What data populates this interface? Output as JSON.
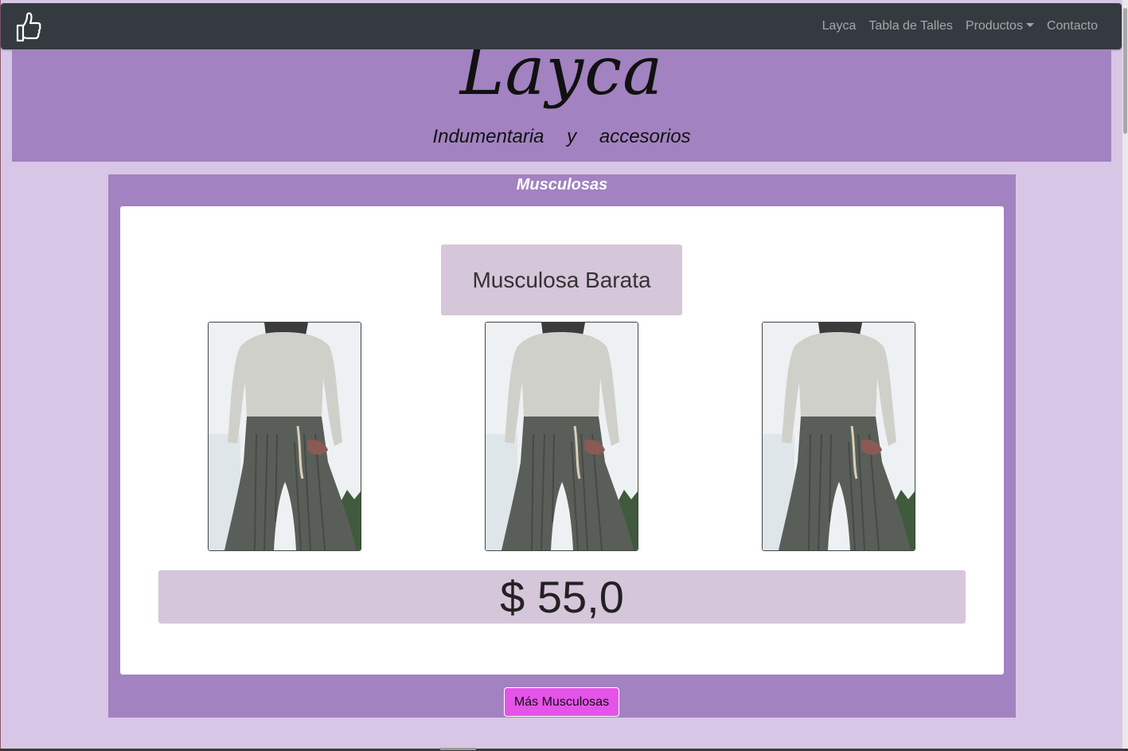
{
  "navbar": {
    "brand_icon": "thumbs-up-icon",
    "links": [
      {
        "label": "Layca"
      },
      {
        "label": "Tabla de Talles"
      },
      {
        "label": "Productos",
        "dropdown": true
      },
      {
        "label": "Contacto"
      }
    ]
  },
  "header": {
    "logo": "Layca",
    "tagline": "Indumentaria y accesorios"
  },
  "section": {
    "title": "Musculosas",
    "product": {
      "name": "Musculosa Barata",
      "price": "$ 55,0",
      "photo_count": 3
    },
    "more_button_label": "Más Musculosas"
  },
  "colors": {
    "page_bg": "#d8c6e6",
    "navbar_bg": "#343a40",
    "header_bg": "#a282c0",
    "panel_bg": "#d6c6da",
    "button_bg": "#e454e8"
  }
}
